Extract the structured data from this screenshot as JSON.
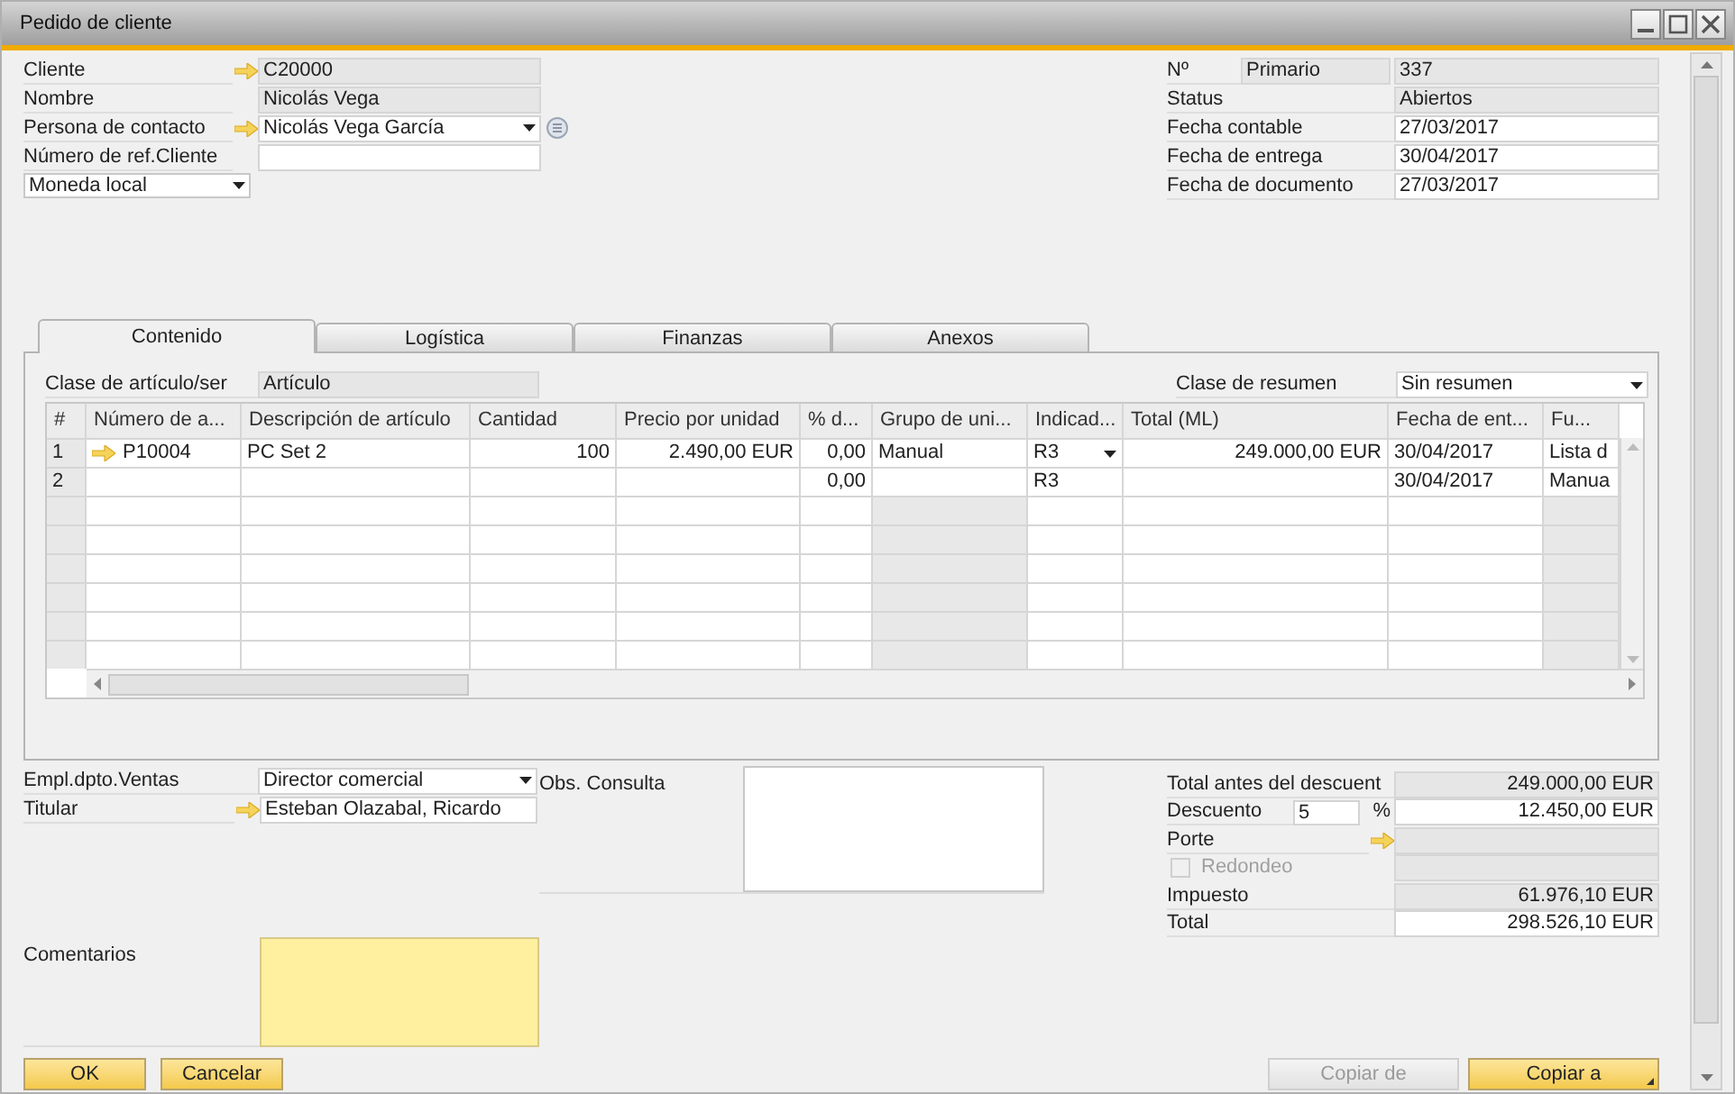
{
  "window": {
    "title": "Pedido de cliente"
  },
  "header_left": [
    {
      "kind": "link",
      "label": "Cliente",
      "value": "C20000"
    },
    {
      "kind": "readonly",
      "label": "Nombre",
      "value": "Nicolás Vega"
    },
    {
      "kind": "link_dropdown",
      "label": "Persona de contacto",
      "value": "Nicolás Vega García"
    },
    {
      "kind": "input",
      "label": "Número de ref.Cliente"
    }
  ],
  "currency": {
    "value": "Moneda local"
  },
  "header_right": {
    "number_label": "Nº",
    "series": "Primario",
    "number": "337",
    "rows": [
      {
        "kind": "readonly",
        "label": "Status",
        "value": "Abiertos"
      },
      {
        "kind": "input",
        "label": "Fecha contable",
        "value": "27/03/2017"
      },
      {
        "kind": "input",
        "label": "Fecha de entrega",
        "value": "30/04/2017"
      },
      {
        "kind": "input",
        "label": "Fecha de documento",
        "value": "27/03/2017"
      }
    ]
  },
  "tabs": [
    {
      "label": "Contenido",
      "selected": true
    },
    {
      "label": "Logística",
      "selected": false
    },
    {
      "label": "Finanzas",
      "selected": false
    },
    {
      "label": "Anexos",
      "selected": false
    }
  ],
  "item_type": {
    "label": "Clase de artículo/ser",
    "value": "Artículo"
  },
  "summary_type": {
    "label": "Clase de resumen",
    "value": "Sin resumen"
  },
  "table": {
    "columns": [
      "#",
      "Número de a...",
      "Descripción de artículo",
      "Cantidad",
      "Precio por unidad",
      "% d...",
      "Grupo de uni...",
      "Indicad...",
      "Total (ML)",
      "Fecha de ent...",
      "Fu..."
    ],
    "rows": [
      {
        "link": true,
        "dropdown": true,
        "cells": [
          "1",
          "P10004",
          "PC Set 2",
          "100",
          "2.490,00 EUR",
          "0,00",
          "Manual",
          "R3",
          "249.000,00 EUR",
          "30/04/2017",
          "Lista d"
        ]
      },
      {
        "link": false,
        "dropdown": false,
        "cells": [
          "2",
          "",
          "",
          "",
          "",
          "0,00",
          "",
          "R3",
          "",
          "30/04/2017",
          "Manua"
        ]
      }
    ]
  },
  "sales_employee": {
    "label": "Empl.dpto.Ventas",
    "value": "Director comercial"
  },
  "owner": {
    "label": "Titular",
    "value": "Esteban Olazabal, Ricardo"
  },
  "remarks": {
    "label": "Obs. Consulta"
  },
  "comments": {
    "label": "Comentarios"
  },
  "totals": [
    {
      "kind": "readonly",
      "label": "Total antes del descuent",
      "value": "249.000,00 EUR"
    },
    {
      "kind": "discount",
      "label": "Descuento",
      "percent": "5",
      "unit": "%",
      "value": "12.450,00 EUR"
    },
    {
      "kind": "link",
      "label": "Porte"
    },
    {
      "kind": "checkbox",
      "label": "Redondeo",
      "checked": false,
      "disabled": true
    },
    {
      "kind": "readonly",
      "label": "Impuesto",
      "value": "61.976,10 EUR"
    },
    {
      "kind": "input",
      "label": "Total",
      "value": "298.526,10 EUR"
    }
  ],
  "buttons_left": [
    {
      "label": "OK",
      "disabled": false,
      "menu": false
    },
    {
      "label": "Cancelar",
      "disabled": false,
      "menu": false
    }
  ],
  "buttons_right": [
    {
      "label": "Copiar de",
      "disabled": true,
      "menu": false
    },
    {
      "label": "Copiar a",
      "disabled": false,
      "menu": true
    }
  ]
}
